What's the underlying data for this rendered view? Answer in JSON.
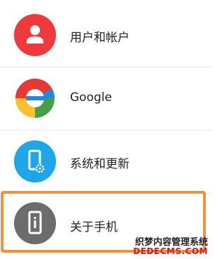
{
  "settings": {
    "items": [
      {
        "label": "用户和帐户",
        "icon": "user-account-icon",
        "color": "#ee3a3a"
      },
      {
        "label": "Google",
        "icon": "google-g-icon",
        "color": "#ffffff"
      },
      {
        "label": "系统和更新",
        "icon": "phone-gear-icon",
        "color": "#1ea6e8"
      },
      {
        "label": "关于手机",
        "icon": "phone-info-icon",
        "color": "#6c6c6c"
      }
    ],
    "highlight_color": "#f0913f"
  },
  "watermark": {
    "line1": "织梦内容管理系统",
    "line2": "DEDECMS.COM"
  }
}
